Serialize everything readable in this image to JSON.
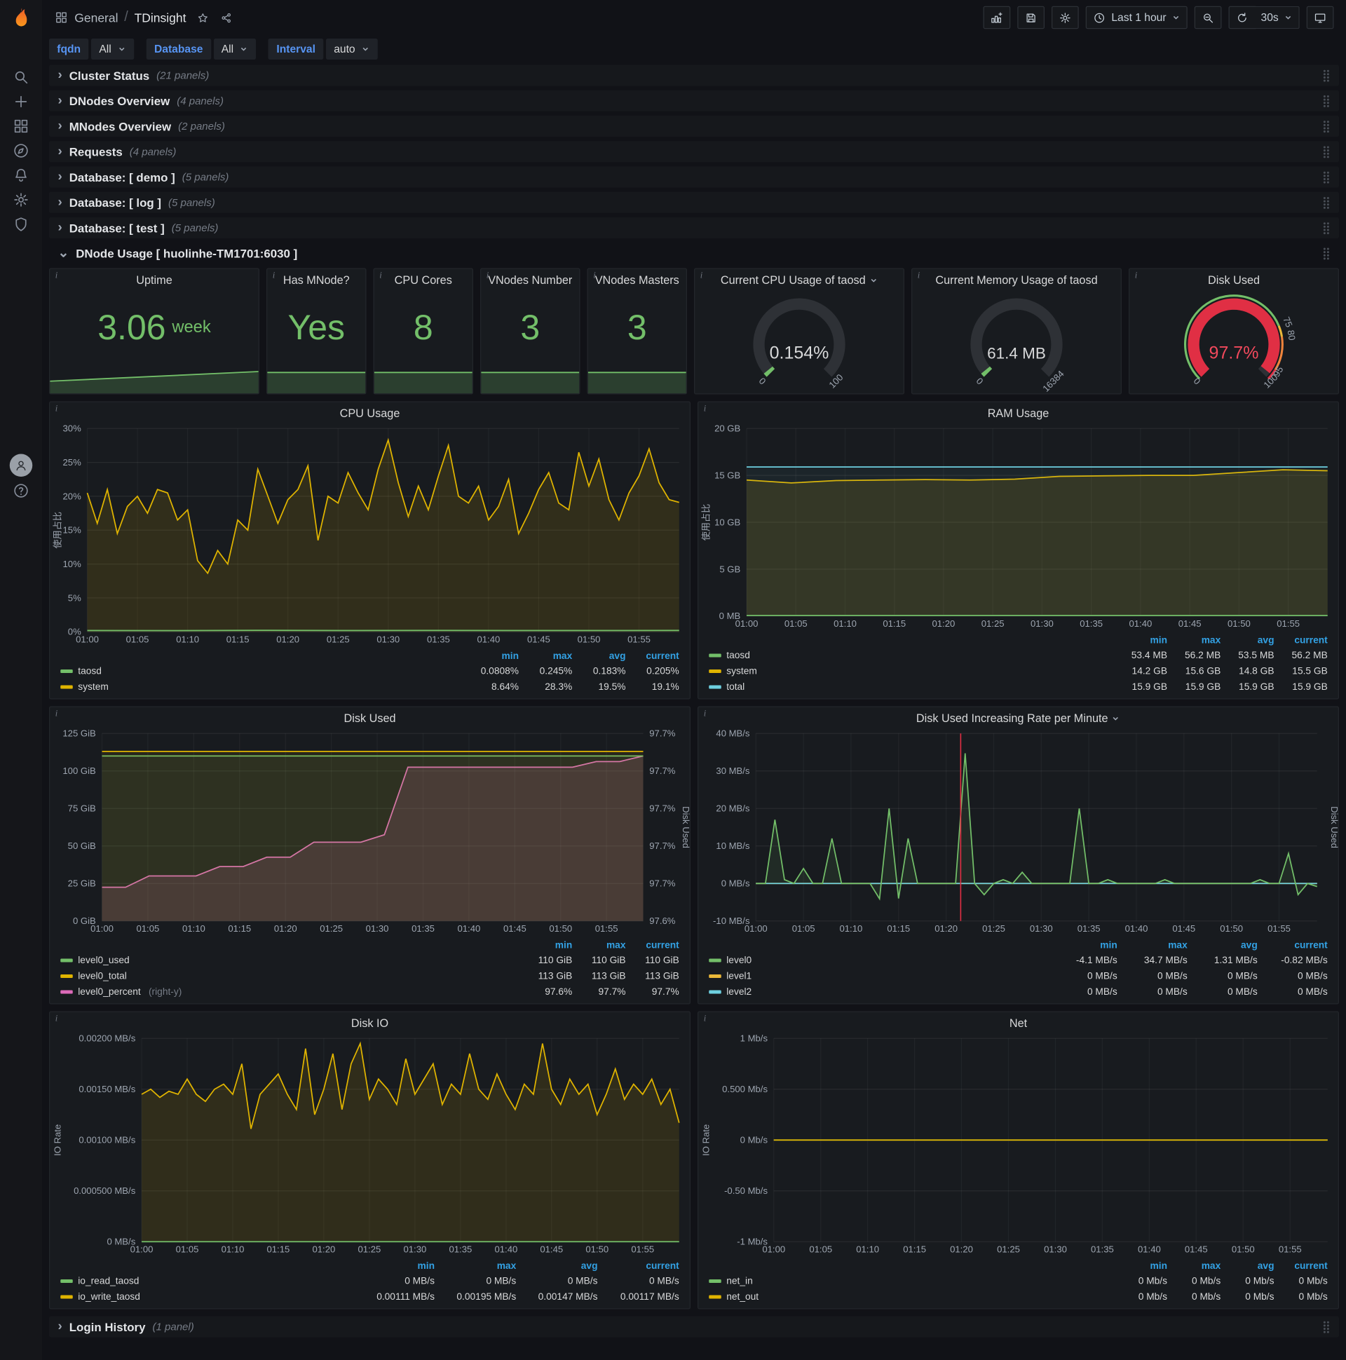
{
  "colors": {
    "green": "#73bf69",
    "yellow": "#e0b400",
    "cyan_blue": "#6ed0e0",
    "variable_blue": "#5794f2",
    "pink": "#dd6bba",
    "red": "#e02f44",
    "red_text": "#f2495c",
    "link_blue": "#33a2e5",
    "brand_orange": "#f05a28",
    "panel_bg": "#181b1f",
    "page_bg": "#111217"
  },
  "sidebar": {
    "items": [
      {
        "icon": "search",
        "name": "search"
      },
      {
        "icon": "plus",
        "name": "create"
      },
      {
        "icon": "dashboards",
        "name": "dashboards"
      },
      {
        "icon": "explore",
        "name": "explore"
      },
      {
        "icon": "alerting",
        "name": "alerting"
      },
      {
        "icon": "settings",
        "name": "configuration"
      },
      {
        "icon": "shield",
        "name": "server-admin"
      }
    ],
    "bottom": [
      {
        "icon": "user",
        "name": "user-avatar"
      },
      {
        "icon": "help",
        "name": "help"
      }
    ]
  },
  "nav": {
    "breadcrumb_section": "General",
    "breadcrumb_sep": "/",
    "breadcrumb_title": "TDinsight",
    "time_range": "Last 1 hour",
    "refresh_interval": "30s",
    "right": [
      {
        "name": "add-panel-button",
        "icon": "panel-add"
      },
      {
        "name": "save-dashboard-button",
        "icon": "save"
      },
      {
        "name": "dashboard-settings-button",
        "icon": "settings"
      },
      {
        "name": "time-range-picker",
        "icon": "clock",
        "label": "Last 1 hour",
        "caret": true
      },
      {
        "name": "zoom-out-button",
        "icon": "zoom-out"
      },
      {
        "name": "refresh-button",
        "icon": "sync",
        "group": "start"
      },
      {
        "name": "refresh-interval-dropdown",
        "label": "30s",
        "caret": true,
        "group": "end"
      },
      {
        "name": "tv-mode-button",
        "icon": "monitor"
      }
    ]
  },
  "variables": [
    {
      "name": "fqdn",
      "label": "fqdn",
      "value": "All"
    },
    {
      "name": "database",
      "label": "Database",
      "value": "All"
    },
    {
      "name": "interval",
      "label": "Interval",
      "value": "auto"
    }
  ],
  "rows_top": [
    {
      "title": "Cluster Status",
      "count": "(21 panels)"
    },
    {
      "title": "DNodes Overview",
      "count": "(4 panels)"
    },
    {
      "title": "MNodes Overview",
      "count": "(2 panels)"
    },
    {
      "title": "Requests",
      "count": "(4 panels)"
    },
    {
      "title": "Database: [ demo ]",
      "count": "(5 panels)"
    },
    {
      "title": "Database: [ log ]",
      "count": "(5 panels)"
    },
    {
      "title": "Database: [ test ]",
      "count": "(5 panels)"
    }
  ],
  "expanded_row": {
    "title": "DNode Usage [ huolinhe-TM1701:6030 ]"
  },
  "bottom_row": {
    "title": "Login History",
    "count": "(1 panel)"
  },
  "stats": [
    {
      "title": "Uptime",
      "value": "3.06",
      "unit": "week",
      "spark": "rising"
    },
    {
      "title": "Has MNode?",
      "value": "Yes",
      "unit": "",
      "spark": "flat"
    },
    {
      "title": "CPU Cores",
      "value": "8",
      "unit": "",
      "spark": "flat"
    },
    {
      "title": "VNodes Number",
      "value": "3",
      "unit": "",
      "spark": "flat"
    },
    {
      "title": "VNodes Masters",
      "value": "3",
      "unit": "",
      "spark": "flat"
    }
  ],
  "gauges": [
    {
      "title": "Current CPU Usage of taosd",
      "caret": true,
      "value": "0.154%",
      "fraction": 0.00154,
      "arc_color": "#73bf69",
      "value_color": "#d8d9da",
      "labels": [
        {
          "f": 0,
          "t": "0"
        },
        {
          "f": 1,
          "t": "100"
        }
      ]
    },
    {
      "title": "Current Memory Usage of taosd",
      "caret": false,
      "value": "61.4 MB",
      "fraction": 0.0037,
      "arc_color": "#73bf69",
      "value_color": "#d8d9da",
      "labels": [
        {
          "f": 0,
          "t": "0"
        },
        {
          "f": 1,
          "t": "16384"
        }
      ]
    },
    {
      "title": "Disk Used",
      "caret": false,
      "value": "97.7%",
      "fraction": 0.977,
      "arc_color": "#e02f44",
      "value_color": "#f2495c",
      "ring": [
        {
          "to": 0.75,
          "color": "#73bf69"
        },
        {
          "to": 0.8,
          "color": "#eab839"
        },
        {
          "to": 0.95,
          "color": "#ef843c"
        },
        {
          "to": 1,
          "color": "#e02f44"
        }
      ],
      "labels": [
        {
          "f": 0,
          "t": "0"
        },
        {
          "f": 0.75,
          "t": "75"
        },
        {
          "f": 0.8,
          "t": "80"
        },
        {
          "f": 0.95,
          "t": "95"
        },
        {
          "f": 1,
          "t": "100"
        }
      ]
    }
  ],
  "time_axis": [
    "01:00",
    "01:05",
    "01:10",
    "01:15",
    "01:20",
    "01:25",
    "01:30",
    "01:35",
    "01:40",
    "01:45",
    "01:50",
    "01:55"
  ],
  "chart_data": [
    {
      "type": "line",
      "title": "CPU Usage",
      "caret": false,
      "ylabel": "使用占比",
      "ylim": [
        0,
        30
      ],
      "yticks": [
        "30%",
        "25%",
        "20%",
        "15%",
        "10%",
        "5%",
        "0%"
      ],
      "series": [
        {
          "name": "system",
          "color": "#e0b400",
          "fill": 0.13,
          "values": [
            20.5,
            16,
            21,
            14.5,
            18.5,
            20,
            17.5,
            21,
            20.5,
            16.5,
            18,
            10.5,
            8.64,
            12,
            10,
            16.5,
            15,
            24,
            20,
            16,
            19.5,
            21,
            24.5,
            13.5,
            20,
            19,
            23.5,
            20.5,
            18,
            24,
            28.3,
            22,
            17,
            21.5,
            18,
            23,
            27.5,
            20,
            19,
            21.5,
            16.5,
            18.5,
            22.5,
            14.5,
            17.5,
            21,
            23.5,
            19,
            18,
            26.5,
            21.5,
            25.5,
            19.5,
            16.5,
            20.5,
            23,
            27,
            22,
            19.5,
            19.1
          ]
        },
        {
          "name": "taosd",
          "color": "#73bf69",
          "fill": 0.1,
          "values": [
            0.2,
            0.18,
            0.22,
            0.19,
            0.21,
            0.2,
            0.19,
            0.21
          ]
        }
      ],
      "legend": {
        "cols": [
          "min",
          "max",
          "avg",
          "current"
        ],
        "rows": [
          {
            "name": "taosd",
            "color": "#73bf69",
            "values": [
              "0.0808%",
              "0.245%",
              "0.183%",
              "0.205%"
            ]
          },
          {
            "name": "system",
            "color": "#e0b400",
            "values": [
              "8.64%",
              "28.3%",
              "19.5%",
              "19.1%"
            ]
          }
        ]
      }
    },
    {
      "type": "line",
      "title": "RAM Usage",
      "caret": false,
      "ylabel": "使用占比",
      "ylim": [
        0,
        20
      ],
      "yticks": [
        "20 GB",
        "15 GB",
        "10 GB",
        "5 GB",
        "0 MB"
      ],
      "series": [
        {
          "name": "system",
          "color": "#e0b400",
          "fill": 0.13,
          "values": [
            14.5,
            14.2,
            14.45,
            14.5,
            14.55,
            14.5,
            14.6,
            14.9,
            14.95,
            15.0,
            15.0,
            15.3,
            15.6,
            15.5
          ]
        },
        {
          "name": "total",
          "color": "#6ed0e0",
          "fill": 0.06,
          "values": [
            15.9,
            15.9
          ]
        },
        {
          "name": "taosd",
          "color": "#73bf69",
          "fill": 0.1,
          "values": [
            0.055,
            0.055
          ]
        }
      ],
      "legend": {
        "cols": [
          "min",
          "max",
          "avg",
          "current"
        ],
        "rows": [
          {
            "name": "taosd",
            "color": "#73bf69",
            "values": [
              "53.4 MB",
              "56.2 MB",
              "53.5 MB",
              "56.2 MB"
            ]
          },
          {
            "name": "system",
            "color": "#e0b400",
            "values": [
              "14.2 GB",
              "15.6 GB",
              "14.8 GB",
              "15.5 GB"
            ]
          },
          {
            "name": "total",
            "color": "#6ed0e0",
            "values": [
              "15.9 GB",
              "15.9 GB",
              "15.9 GB",
              "15.9 GB"
            ]
          }
        ]
      }
    },
    {
      "type": "line",
      "title": "Disk Used",
      "caret": false,
      "ylabel": "",
      "ylim": [
        0,
        125
      ],
      "yticks": [
        "125 GiB",
        "100 GiB",
        "75 GiB",
        "50 GiB",
        "25 GiB",
        "0 GiB"
      ],
      "right_ticks": [
        "97.7%",
        "97.7%",
        "97.7%",
        "97.7%",
        "97.7%",
        "97.6%"
      ],
      "ylim_right": [
        97.63,
        97.73
      ],
      "right_axis_label": "Disk Used",
      "series": [
        {
          "name": "level0_percent",
          "color": "#dd6bba",
          "axis": "right",
          "fill": 0.16,
          "values": [
            97.648,
            97.648,
            97.654,
            97.654,
            97.654,
            97.659,
            97.659,
            97.664,
            97.664,
            97.672,
            97.672,
            97.672,
            97.676,
            97.712,
            97.712,
            97.712,
            97.712,
            97.712,
            97.712,
            97.712,
            97.712,
            97.715,
            97.715,
            97.718
          ]
        },
        {
          "name": "level0_used",
          "color": "#73bf69",
          "fill": 0.08,
          "values": [
            110,
            110
          ]
        },
        {
          "name": "level0_total",
          "color": "#e0b400",
          "fill": 0.08,
          "values": [
            113,
            113
          ]
        }
      ],
      "legend": {
        "cols": [
          "min",
          "max",
          "current"
        ],
        "rows": [
          {
            "name": "level0_used",
            "color": "#73bf69",
            "values": [
              "110 GiB",
              "110 GiB",
              "110 GiB"
            ]
          },
          {
            "name": "level0_total",
            "color": "#e0b400",
            "values": [
              "113 GiB",
              "113 GiB",
              "113 GiB"
            ]
          },
          {
            "name": "level0_percent",
            "color": "#dd6bba",
            "suffix": "(right-y)",
            "values": [
              "97.6%",
              "97.7%",
              "97.7%"
            ]
          }
        ]
      }
    },
    {
      "type": "line",
      "title": "Disk Used Increasing Rate per Minute",
      "caret": true,
      "ylabel": "",
      "ylim": [
        -10,
        40
      ],
      "yticks": [
        "40 MB/s",
        "30 MB/s",
        "20 MB/s",
        "10 MB/s",
        "0 MB/s",
        "-10 MB/s"
      ],
      "right_axis_label": "Disk Used",
      "annotation": 0.365,
      "series": [
        {
          "name": "level1",
          "color": "#eab839",
          "fill": 0,
          "values": [
            0,
            0
          ]
        },
        {
          "name": "level2",
          "color": "#6ed0e0",
          "fill": 0,
          "values": [
            0,
            0
          ]
        },
        {
          "name": "level0",
          "color": "#73bf69",
          "fill": 0.1,
          "values": [
            0,
            0,
            17,
            1,
            0,
            4,
            0,
            0,
            12,
            0,
            0,
            0,
            0,
            -4.1,
            20,
            -4,
            12,
            0,
            0,
            0,
            0,
            0,
            34.7,
            0,
            -3,
            0,
            1,
            0,
            3,
            0,
            0,
            0,
            0,
            0,
            20,
            0,
            0,
            1,
            0,
            0,
            0,
            0,
            0,
            1,
            0,
            0,
            0,
            0,
            0,
            0,
            0,
            0,
            0,
            1,
            0,
            0,
            8,
            -3,
            0,
            -0.82
          ]
        }
      ],
      "legend": {
        "cols": [
          "min",
          "max",
          "avg",
          "current"
        ],
        "rows": [
          {
            "name": "level0",
            "color": "#73bf69",
            "values": [
              "-4.1 MB/s",
              "34.7 MB/s",
              "1.31 MB/s",
              "-0.82 MB/s"
            ]
          },
          {
            "name": "level1",
            "color": "#eab839",
            "values": [
              "0 MB/s",
              "0 MB/s",
              "0 MB/s",
              "0 MB/s"
            ]
          },
          {
            "name": "level2",
            "color": "#6ed0e0",
            "values": [
              "0 MB/s",
              "0 MB/s",
              "0 MB/s",
              "0 MB/s"
            ]
          }
        ]
      }
    },
    {
      "type": "line",
      "title": "Disk IO",
      "caret": false,
      "ylabel": "IO Rate",
      "ylim": [
        0,
        0.002
      ],
      "yticks": [
        "0.00200 MB/s",
        "0.00150 MB/s",
        "0.00100 MB/s",
        "0.000500 MB/s",
        "0 MB/s"
      ],
      "series": [
        {
          "name": "io_write_taosd",
          "color": "#e0b400",
          "fill": 0.12,
          "values": [
            0.00145,
            0.0015,
            0.00142,
            0.00148,
            0.00145,
            0.0016,
            0.00145,
            0.00138,
            0.0015,
            0.00155,
            0.00145,
            0.00175,
            0.00111,
            0.00145,
            0.00155,
            0.00165,
            0.00145,
            0.0013,
            0.0019,
            0.00125,
            0.0015,
            0.00185,
            0.0013,
            0.00175,
            0.00195,
            0.0014,
            0.0016,
            0.0015,
            0.00135,
            0.0018,
            0.00145,
            0.0016,
            0.00175,
            0.00135,
            0.00155,
            0.00145,
            0.00185,
            0.0015,
            0.0014,
            0.00165,
            0.00145,
            0.0013,
            0.00155,
            0.00145,
            0.00195,
            0.0015,
            0.00135,
            0.0016,
            0.00145,
            0.00155,
            0.00125,
            0.00145,
            0.0017,
            0.0014,
            0.00155,
            0.00145,
            0.0016,
            0.00135,
            0.0015,
            0.00117
          ]
        },
        {
          "name": "io_read_taosd",
          "color": "#73bf69",
          "fill": 0.1,
          "values": [
            0,
            0
          ]
        }
      ],
      "legend": {
        "cols": [
          "min",
          "max",
          "avg",
          "current"
        ],
        "rows": [
          {
            "name": "io_read_taosd",
            "color": "#73bf69",
            "values": [
              "0 MB/s",
              "0 MB/s",
              "0 MB/s",
              "0 MB/s"
            ]
          },
          {
            "name": "io_write_taosd",
            "color": "#e0b400",
            "values": [
              "0.00111 MB/s",
              "0.00195 MB/s",
              "0.00147 MB/s",
              "0.00117 MB/s"
            ]
          }
        ]
      }
    },
    {
      "type": "line",
      "title": "Net",
      "caret": false,
      "ylabel": "IO Rate",
      "ylim": [
        -1,
        1
      ],
      "yticks": [
        "1 Mb/s",
        "0.500 Mb/s",
        "0 Mb/s",
        "-0.50 Mb/s",
        "-1 Mb/s"
      ],
      "series": [
        {
          "name": "net_in",
          "color": "#73bf69",
          "fill": 0,
          "values": [
            0,
            0
          ]
        },
        {
          "name": "net_out",
          "color": "#e0b400",
          "fill": 0,
          "values": [
            0,
            0
          ]
        }
      ],
      "legend": {
        "cols": [
          "min",
          "max",
          "avg",
          "current"
        ],
        "rows": [
          {
            "name": "net_in",
            "color": "#73bf69",
            "values": [
              "0 Mb/s",
              "0 Mb/s",
              "0 Mb/s",
              "0 Mb/s"
            ]
          },
          {
            "name": "net_out",
            "color": "#e0b400",
            "values": [
              "0 Mb/s",
              "0 Mb/s",
              "0 Mb/s",
              "0 Mb/s"
            ]
          }
        ]
      }
    }
  ]
}
